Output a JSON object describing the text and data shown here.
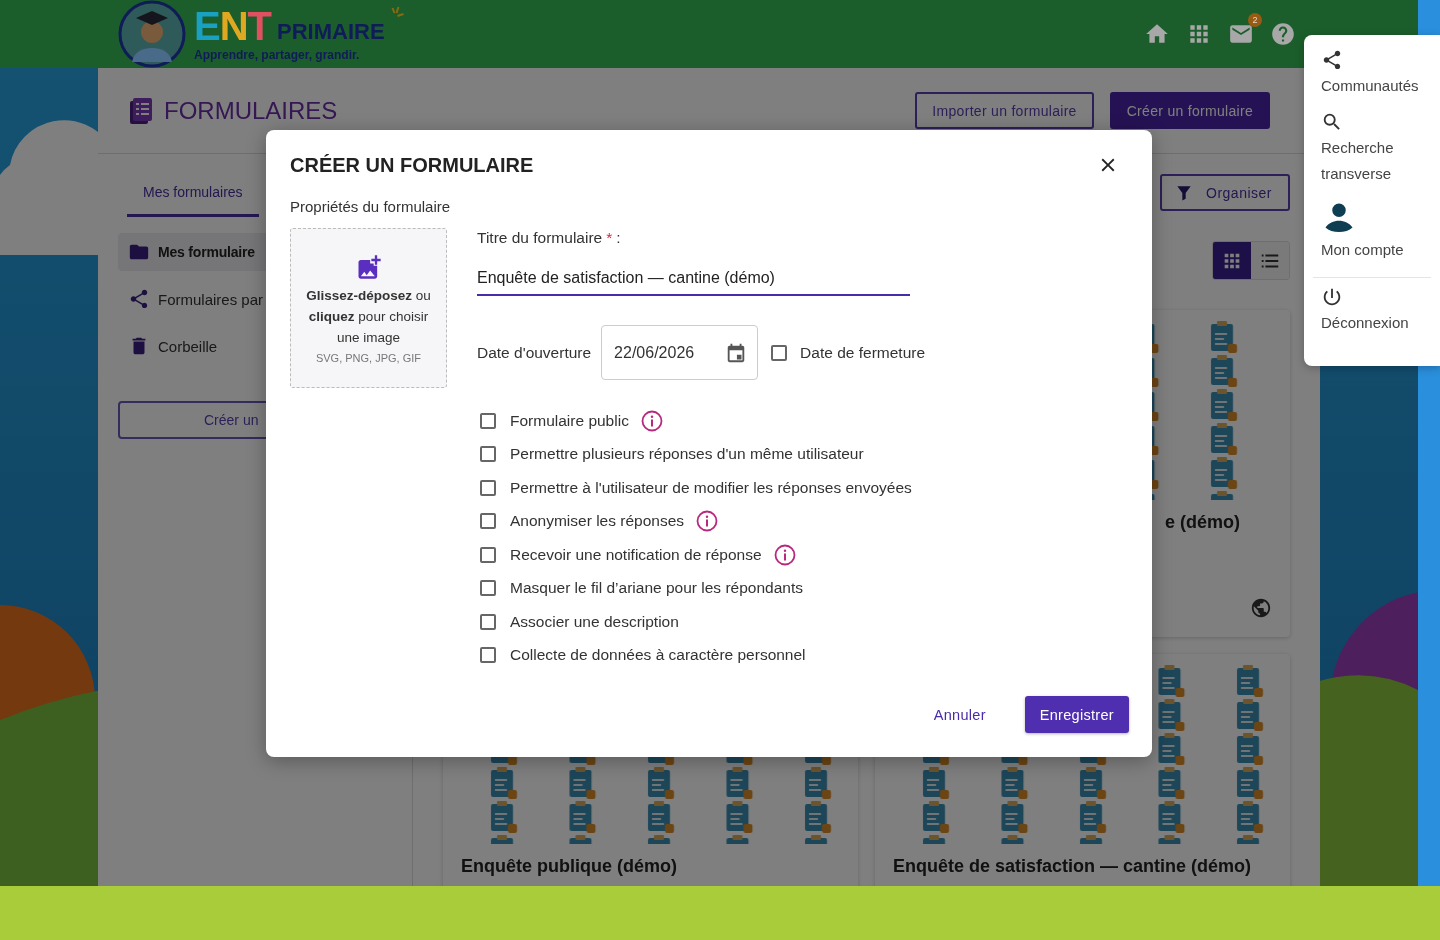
{
  "header": {
    "logo_letters": [
      {
        "text": "E",
        "color": "#1aa0c0"
      },
      {
        "text": "N",
        "color": "#e0a820"
      },
      {
        "text": "T",
        "color": "#e05060"
      }
    ],
    "brand": "PRIMAIRE",
    "tagline": "Apprendre, partager, grandir.",
    "icons": [
      {
        "kind": "home"
      },
      {
        "kind": "apps"
      },
      {
        "kind": "mail",
        "badge": "2"
      },
      {
        "kind": "help"
      }
    ]
  },
  "page": {
    "title": "FORMULAIRES",
    "actions": [
      {
        "label": "Importer un formulaire",
        "kind": "outlined"
      },
      {
        "label": "Créer un formulaire",
        "kind": "filled"
      }
    ]
  },
  "sidebar": {
    "tabs": [
      {
        "label": "Mes formulaires",
        "selected": true
      }
    ],
    "items": [
      {
        "label": "Mes formulaire",
        "selected": true
      },
      {
        "label": "Formulaires par",
        "selected": false
      },
      {
        "label": "Corbeille",
        "selected": false
      }
    ],
    "button": "Créer un"
  },
  "toolbar": {
    "organize": "Organiser",
    "views": [
      {
        "selected": true
      },
      {
        "selected": false
      }
    ]
  },
  "cards": [
    {
      "title": "e (démo)",
      "public": true
    },
    {
      "title": "Enquête publique (démo)"
    },
    {
      "title": "Enquête de satisfaction — cantine (démo)"
    }
  ],
  "dialog": {
    "title": "CRÉER UN FORMULAIRE",
    "section": "Propriétés du formulaire",
    "dropzone": {
      "text": "**Glissez-déposez** ou **cliquez** pour choisir une image",
      "formats": "SVG, PNG, JPG, GIF"
    },
    "title_field": {
      "label": "Titre du formulaire",
      "required_mark": "*",
      "colon": ":",
      "value": "Enquête de satisfaction — cantine (démo)"
    },
    "opening_date": {
      "label": "Date d'ouverture",
      "value": "22/06/2026"
    },
    "closing_date": {
      "label": "Date de fermeture",
      "checked": false
    },
    "options": [
      {
        "label": "Formulaire public",
        "checked": false,
        "info": true
      },
      {
        "label": "Permettre plusieurs réponses d'un même utilisateur",
        "checked": false,
        "info": false
      },
      {
        "label": "Permettre à l'utilisateur de modifier les réponses envoyées",
        "checked": false,
        "info": false
      },
      {
        "label": "Anonymiser les réponses",
        "checked": false,
        "info": true
      },
      {
        "label": "Recevoir une notification de réponse",
        "checked": false,
        "info": true
      },
      {
        "label": "Masquer le fil d’ariane pour les répondants",
        "checked": false,
        "info": false
      },
      {
        "label": "Associer une description",
        "checked": false,
        "info": false
      },
      {
        "label": "Collecte de données à caractère personnel",
        "checked": false,
        "info": false
      }
    ],
    "buttons": [
      {
        "label": "Annuler",
        "kind": "text"
      },
      {
        "label": "Enregistrer",
        "kind": "filled"
      }
    ]
  },
  "user_menu": {
    "items": [
      {
        "label": "Communautés"
      },
      {
        "label": "Recherche transverse"
      },
      {
        "label": "Mon compte"
      },
      {
        "label": "Déconnexion"
      }
    ]
  }
}
